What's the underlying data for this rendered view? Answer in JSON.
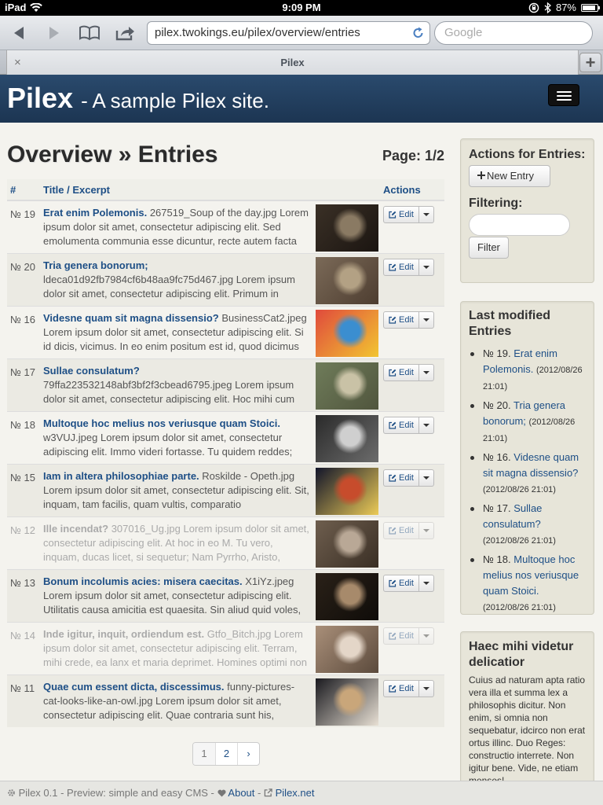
{
  "status": {
    "device": "iPad",
    "time": "9:09 PM",
    "battery": "87%",
    "battery_level": 0.87
  },
  "browser": {
    "url": "pilex.twokings.eu/pilex/overview/entries",
    "search_placeholder": "Google",
    "tab_title": "Pilex",
    "tab_close": "×",
    "tab_add": "+"
  },
  "site": {
    "brand": "Pilex",
    "tagline": "- A sample Pilex site."
  },
  "main": {
    "title": "Overview » Entries",
    "page_indicator": "Page: 1/2",
    "columns": [
      "#",
      "Title / Excerpt",
      "Actions"
    ],
    "edit_label": "Edit",
    "rows": [
      {
        "num": "№ 19",
        "title": "Erat enim Polemonis.",
        "excerpt": "267519_Soup of the day.jpg Lorem ipsum dolor sit amet, consectetur adipiscing elit. Sed emolumenta communia esse dicuntur, recte autem facta",
        "faded": false
      },
      {
        "num": "№ 20",
        "title": "Tria genera bonorum;",
        "excerpt": "ldeca01d92fb7984cf6b48aa9fc75d467.jpg Lorem ipsum dolor sit amet, consectetur adipiscing elit. Primum in",
        "faded": false
      },
      {
        "num": "№ 16",
        "title": "Videsne quam sit magna dissensio?",
        "excerpt": "BusinessCat2.jpeg Lorem ipsum dolor sit amet, consectetur adipiscing elit. Si id dicis, vicimus. In eo enim positum est id, quod dicimus",
        "faded": false
      },
      {
        "num": "№ 17",
        "title": "Sullae consulatum?",
        "excerpt": "79ffa223532148abf3bf2f3cbead6795.jpeg Lorem ipsum dolor sit amet, consectetur adipiscing elit. Hoc mihi cum",
        "faded": false
      },
      {
        "num": "№ 18",
        "title": "Multoque hoc melius nos veriusque quam Stoici.",
        "excerpt": "w3VUJ.jpeg Lorem ipsum dolor sit amet, consectetur adipiscing elit. Immo videri fortasse. Tu quidem reddes;",
        "faded": false
      },
      {
        "num": "№ 15",
        "title": "Iam in altera philosophiae parte.",
        "excerpt": "Roskilde - Opeth.jpg Lorem ipsum dolor sit amet, consectetur adipiscing elit. Sit, inquam, tam facilis, quam vultis, comparatio",
        "faded": false
      },
      {
        "num": "№ 12",
        "title": "Ille incendat?",
        "excerpt": "307016_Ug.jpg Lorem ipsum dolor sit amet, consectetur adipiscing elit. At hoc in eo M. Tu vero, inquam, ducas licet, si sequetur; Nam Pyrrho, Aristo,",
        "faded": true
      },
      {
        "num": "№ 13",
        "title": "Bonum incolumis acies: misera caecitas.",
        "excerpt": "X1iYz.jpeg Lorem ipsum dolor sit amet, consectetur adipiscing elit. Utilitatis causa amicitia est quaesita. Sin aliud quid voles,",
        "faded": false
      },
      {
        "num": "№ 14",
        "title": "Inde igitur, inquit, ordiendum est.",
        "excerpt": "Gtfo_Bitch.jpg Lorem ipsum dolor sit amet, consectetur adipiscing elit. Terram, mihi crede, ea lanx et maria deprimet. Homines optimi non",
        "faded": true
      },
      {
        "num": "№ 11",
        "title": "Quae cum essent dicta, discessimus.",
        "excerpt": "funny-pictures-cat-looks-like-an-owl.jpg Lorem ipsum dolor sit amet, consectetur adipiscing elit. Quae contraria sunt his,",
        "faded": false
      }
    ],
    "pagination": [
      "1",
      "2",
      "›"
    ]
  },
  "sidebar": {
    "actions_title": "Actions for Entries:",
    "new_entry": "New Entry",
    "filtering_title": "Filtering:",
    "filter_value": "",
    "filter_button": "Filter",
    "last_modified_title": "Last modified Entries",
    "recent": [
      {
        "num": "№ 19.",
        "title": "Erat enim Polemonis.",
        "date": "(2012/08/26 21:01)"
      },
      {
        "num": "№ 20.",
        "title": "Tria genera bonorum;",
        "date": "(2012/08/26 21:01)"
      },
      {
        "num": "№ 16.",
        "title": "Videsne quam sit magna dissensio?",
        "date": "(2012/08/26 21:01)"
      },
      {
        "num": "№ 17.",
        "title": "Sullae consulatum?",
        "date": "(2012/08/26 21:01)"
      },
      {
        "num": "№ 18.",
        "title": "Multoque hoc melius nos veriusque quam Stoici.",
        "date": "(2012/08/26 21:01)"
      }
    ],
    "quote_title": "Haec mihi videtur delicatior",
    "quote_text": "Cuius ad naturam apta ratio vera illa et summa lex a philosophis dicitur. Non enim, si omnia non sequebatur, idcirco non erat ortus illinc. Duo Reges: constructio interrete. Non igitur bene. Vide, ne etiam menses!"
  },
  "footer": {
    "left": "Pilex 0.1 - Preview: simple and easy CMS -",
    "about": "About",
    "sep": "-",
    "link": "Pilex.net"
  }
}
